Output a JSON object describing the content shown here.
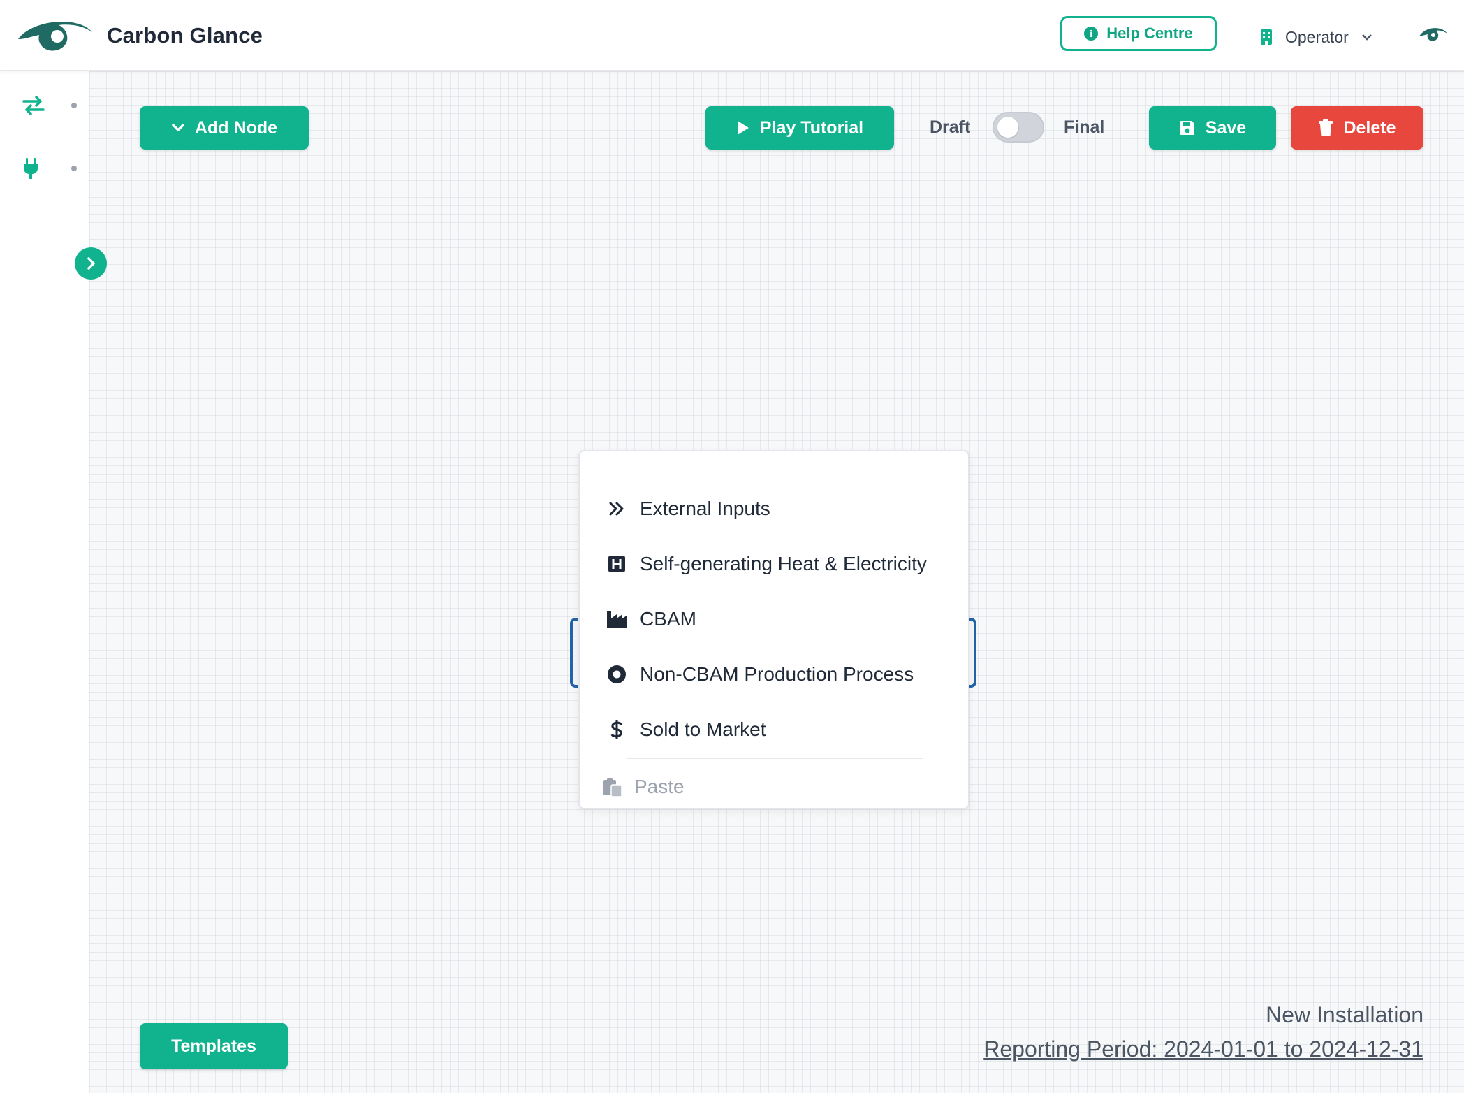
{
  "header": {
    "app_title": "Carbon Glance",
    "help_label": "Help Centre",
    "role_label": "Operator",
    "logo_icon": "eye-logo",
    "accent_color": "#10b38e"
  },
  "sidebar": {
    "items": [
      {
        "icon": "swap-arrows-icon"
      },
      {
        "icon": "plug-icon"
      }
    ],
    "expand_icon": "chevron-right-icon"
  },
  "toolbar": {
    "add_node_label": "Add Node",
    "play_tutorial_label": "Play Tutorial",
    "draft_label": "Draft",
    "final_label": "Final",
    "toggle_state": "draft",
    "save_label": "Save",
    "delete_label": "Delete",
    "delete_color": "#e8473d"
  },
  "menu": {
    "items": [
      {
        "label": "External Inputs",
        "icon": "double-chevron-right-icon"
      },
      {
        "label": "Self-generating Heat & Electricity",
        "icon": "h-square-icon"
      },
      {
        "label": "CBAM",
        "icon": "industry-icon"
      },
      {
        "label": "Non-CBAM Production Process",
        "icon": "dot-circle-icon",
        "selected": true
      },
      {
        "label": "Sold to Market",
        "icon": "dollar-icon"
      }
    ],
    "paste_label": "Paste",
    "paste_icon": "paste-icon"
  },
  "footer": {
    "templates_label": "Templates",
    "installation_name": "New Installation",
    "reporting_period": "Reporting Period: 2024-01-01 to 2024-12-31"
  }
}
